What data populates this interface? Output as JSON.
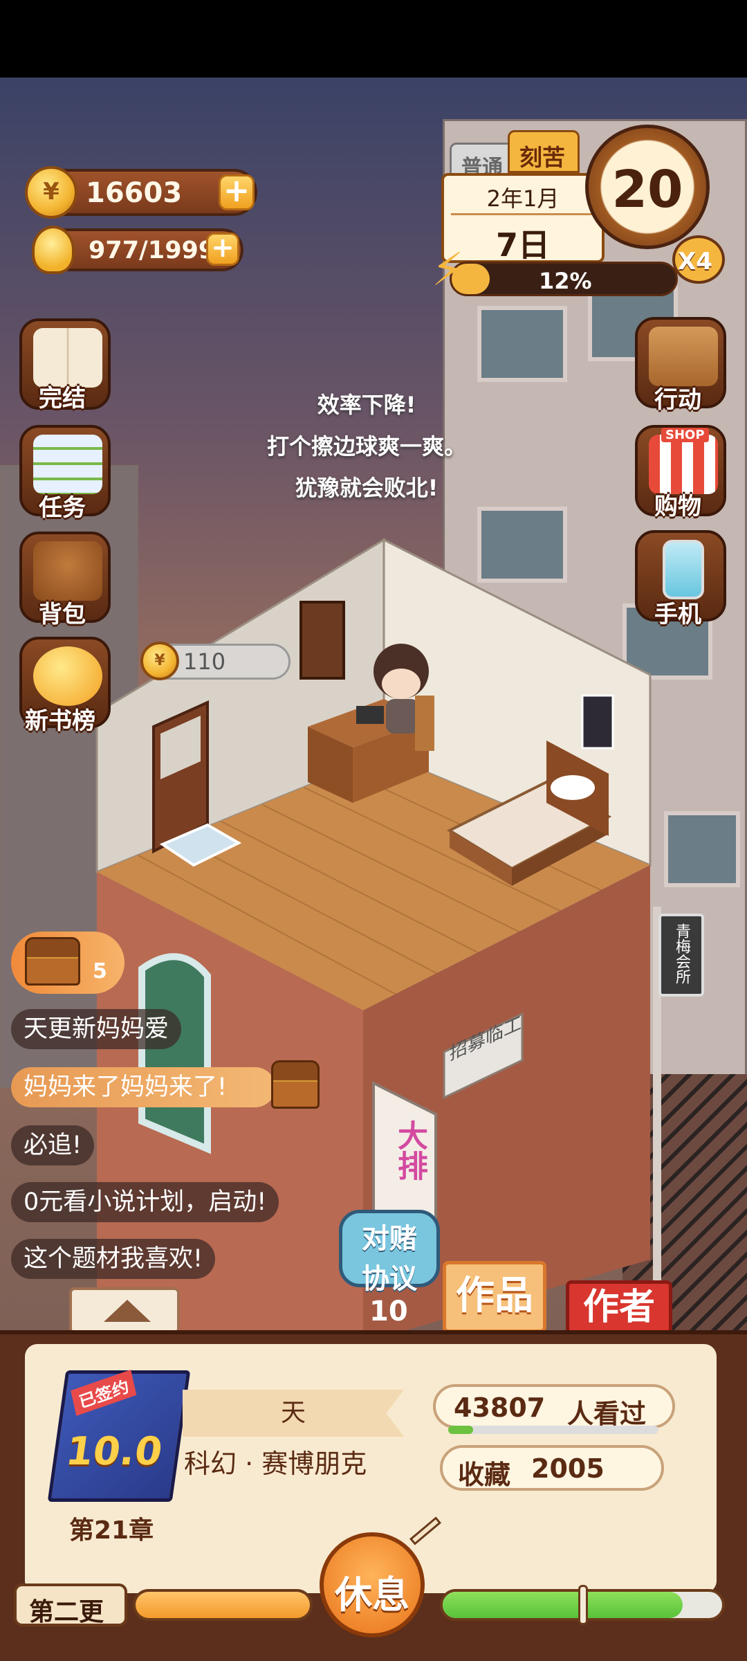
{
  "resources": {
    "coins": "16603",
    "energy": "977/1999",
    "plus": "+"
  },
  "calendar": {
    "mode_left": "普通",
    "mode_right": "刻苦",
    "month": "2年1月",
    "day": "7日",
    "age": "20",
    "multiplier": "X4",
    "efficiency": "12%"
  },
  "left_menu": [
    {
      "label": "完结",
      "icon": "book-icon"
    },
    {
      "label": "任务",
      "icon": "checklist-icon"
    },
    {
      "label": "背包",
      "icon": "backpack-icon"
    },
    {
      "label": "新书榜",
      "icon": "rank-coin-icon"
    }
  ],
  "right_menu": [
    {
      "label": "行动",
      "icon": "door-icon"
    },
    {
      "label": "购物",
      "icon": "shop-icon",
      "badge": "SHOP"
    },
    {
      "label": "手机",
      "icon": "phone-icon"
    }
  ],
  "notice": {
    "line1": "效率下降!",
    "line2": "打个擦边球爽一爽。",
    "line3": "犹豫就会败北!"
  },
  "room": {
    "coin_bubble": "110",
    "sign_recruit": "招募临工",
    "sign_shop": "大排",
    "sign_side": "青梅会所"
  },
  "chest": {
    "count": "5"
  },
  "comments": [
    "天更新妈妈爱",
    "妈妈来了妈妈来了!",
    "必追!",
    "0元看小说计划，启动!",
    "这个题材我喜欢!"
  ],
  "bet": {
    "label_top": "对赌",
    "label_bottom": "协议",
    "count": "10"
  },
  "tabs": {
    "works": "作品",
    "author": "作者"
  },
  "book": {
    "badge": "已签约",
    "score": "10.0",
    "title": "天",
    "genre": "科幻 · 赛博朋克",
    "chapter": "第21章",
    "readers": "43807",
    "readers_suffix": "人看过",
    "favorites_label": "收藏",
    "favorites": "2005"
  },
  "bottom": {
    "update_label": "第二更",
    "rest_label": "休息",
    "orange_progress": 1.0,
    "green_progress": 0.86
  },
  "colors": {
    "accent_orange": "#f39a2a",
    "green": "#58c23a",
    "brown": "#5b2f1c"
  }
}
